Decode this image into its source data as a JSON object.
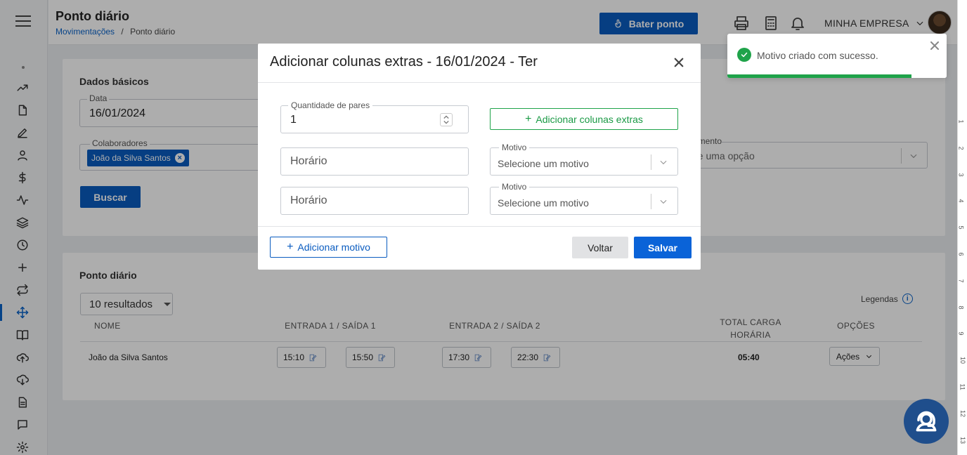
{
  "header": {
    "title": "Ponto diário",
    "breadcrumb_link": "Movimentações",
    "breadcrumb_sep": "/",
    "breadcrumb_current": "Ponto diário",
    "bater_ponto_label": "Bater ponto",
    "company_name": "MINHA EMPRESA"
  },
  "filters": {
    "section_title": "Dados básicos",
    "date_label": "Data",
    "date_value": "16/01/2024",
    "colaboradores_label": "Colaboradores",
    "colaborador_chip": "João da Silva Santos",
    "right_select_label_partial": "amento",
    "right_select_placeholder_partial": "ne uma opção",
    "buscar_label": "Buscar"
  },
  "results": {
    "section_title": "Ponto diário",
    "page_size": "10 resultados",
    "legendas": "Legendas",
    "columns": {
      "nome": "NOME",
      "es1": "ENTRADA 1 / SAÍDA 1",
      "es2": "ENTRADA 2 / SAÍDA 2",
      "total_line1": "TOTAL CARGA",
      "total_line2": "HORÁRIA",
      "opcoes": "OPÇÕES"
    },
    "row": {
      "nome": "João da Silva Santos",
      "entrada1": "15:10",
      "saida1": "15:50",
      "entrada2": "17:30",
      "saida2": "22:30",
      "total": "05:40",
      "acoes": "Ações"
    }
  },
  "modal": {
    "title": "Adicionar colunas extras - 16/01/2024 - Ter",
    "quantidade_label": "Quantidade de pares",
    "quantidade_value": "1",
    "add_colunas_label": "Adicionar colunas extras",
    "horario_placeholder": "Horário",
    "motivo_label": "Motivo",
    "motivo_placeholder": "Selecione um motivo",
    "add_motivo_label": "Adicionar motivo",
    "voltar_label": "Voltar",
    "salvar_label": "Salvar"
  },
  "toast": {
    "message": "Motivo criado com sucesso.",
    "progress_fraction": 0.84,
    "color": "#1fa34a"
  },
  "ruler": [
    "1",
    "2",
    "3",
    "4",
    "5",
    "6",
    "7",
    "8",
    "9",
    "10",
    "11",
    "12",
    "13"
  ],
  "colors": {
    "primary": "#0a5cc0",
    "success": "#1fa34a",
    "support_bubble": "#1f4e8c"
  }
}
